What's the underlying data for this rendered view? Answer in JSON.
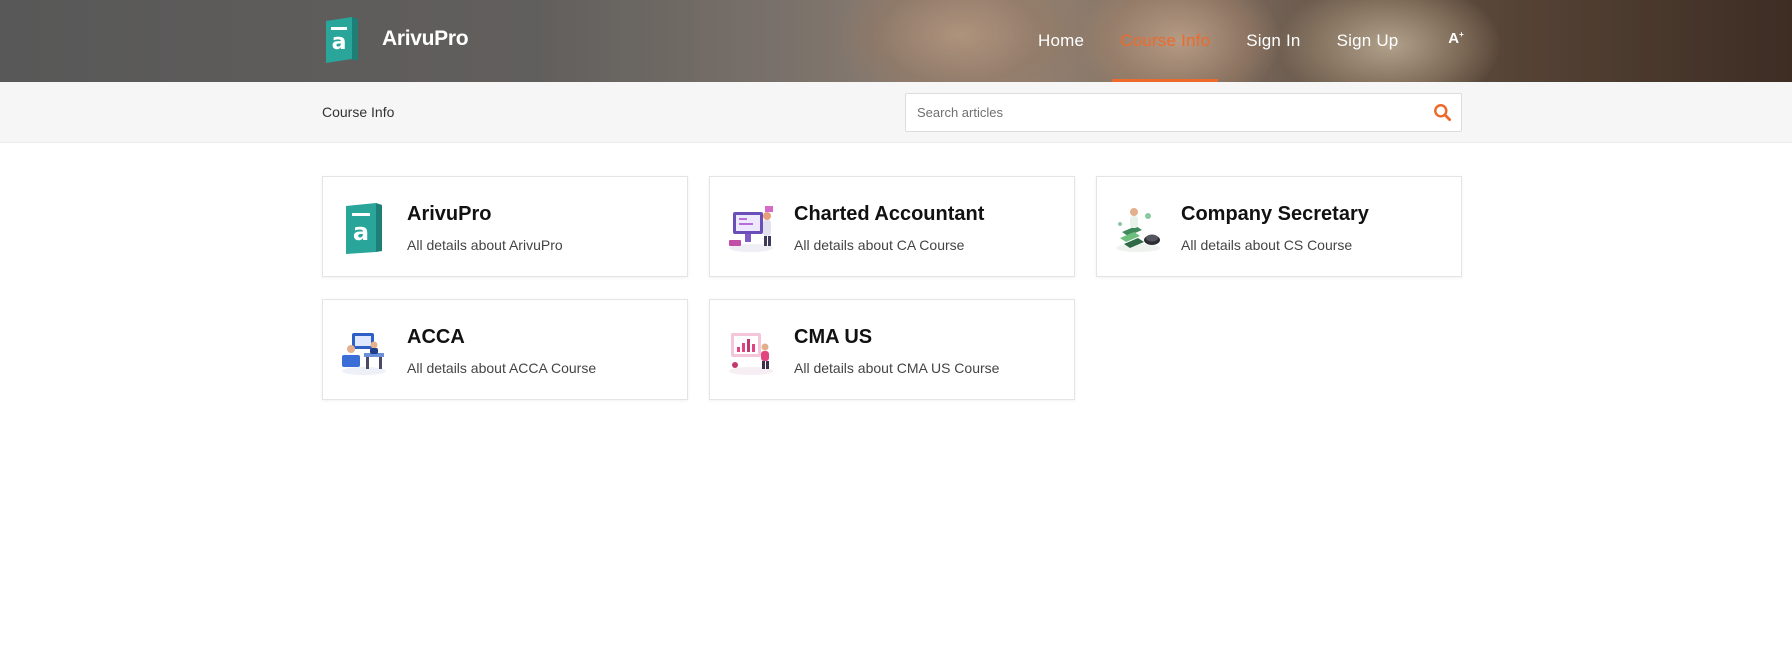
{
  "header": {
    "brand": "ArivuPro",
    "nav": [
      {
        "label": "Home",
        "active": false
      },
      {
        "label": "Course Info",
        "active": true
      },
      {
        "label": "Sign In",
        "active": false
      },
      {
        "label": "Sign Up",
        "active": false
      }
    ],
    "font_toggle_label": "A",
    "font_toggle_sup": "+"
  },
  "subbar": {
    "breadcrumb": "Course Info",
    "search_placeholder": "Search articles"
  },
  "colors": {
    "accent": "#ee6a2a",
    "brand_teal": "#2aa59a"
  },
  "cards": [
    {
      "title": "ArivuPro",
      "desc": "All details about ArivuPro",
      "icon": "arivupro-logo-icon"
    },
    {
      "title": "Charted Accountant",
      "desc": "All details about CA Course",
      "icon": "accountant-illustration-icon"
    },
    {
      "title": "Company Secretary",
      "desc": "All details about CS Course",
      "icon": "secretary-illustration-icon"
    },
    {
      "title": "ACCA",
      "desc": "All details about ACCA Course",
      "icon": "acca-illustration-icon"
    },
    {
      "title": "CMA US",
      "desc": "All details about CMA US Course",
      "icon": "cma-illustration-icon"
    }
  ]
}
